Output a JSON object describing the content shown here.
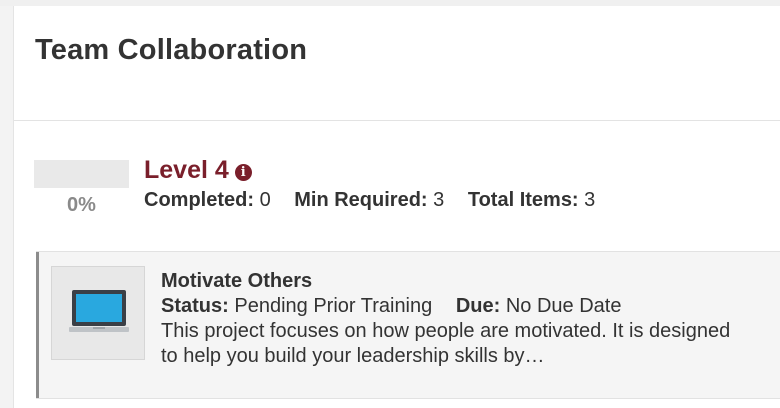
{
  "card": {
    "title": "Team Collaboration"
  },
  "level": {
    "title": "Level 4",
    "progress_label": "0%",
    "progress_fraction": 0,
    "accent_color": "#7a1f2b",
    "info_icon": "info-circle-icon",
    "completed_label": "Completed:",
    "completed_value": "0",
    "min_required_label": "Min Required:",
    "min_required_value": "3",
    "total_items_label": "Total Items:",
    "total_items_value": "3"
  },
  "items": [
    {
      "icon": "laptop-icon",
      "title": "Motivate Others",
      "status_label": "Status:",
      "status_value": "Pending Prior Training",
      "due_label": "Due:",
      "due_value": "No Due Date",
      "description": "This project focuses on how people are motivated. It is designed to help you build your leadership skills by…"
    }
  ]
}
